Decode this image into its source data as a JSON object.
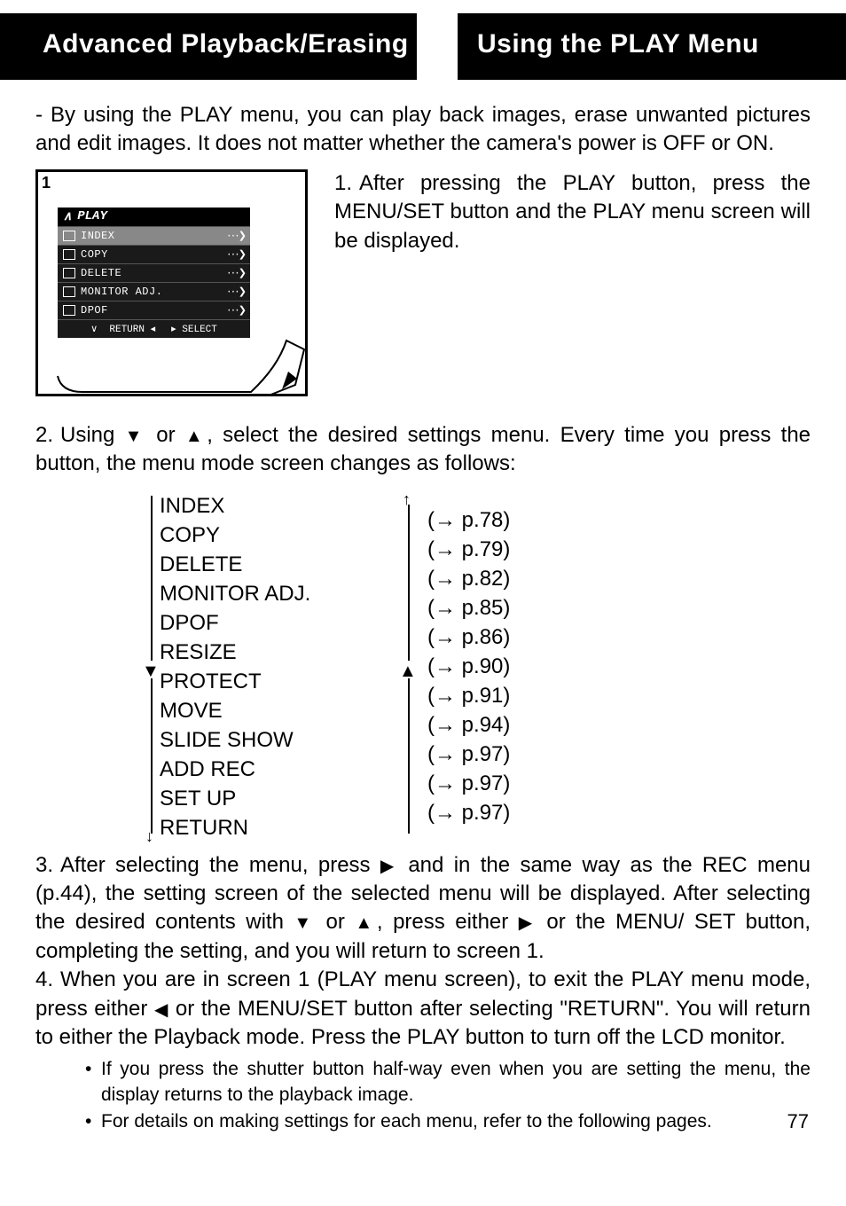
{
  "header": {
    "left": "Advanced Playback/Erasing",
    "right": "Using the PLAY Menu"
  },
  "intro": "By using the PLAY menu, you can play back images, erase unwanted pictures and edit images. It does not matter whether the camera's power is OFF or ON.",
  "lcd": {
    "number": "1",
    "title": "PLAY",
    "rows": [
      "INDEX",
      "COPY",
      "DELETE",
      "MONITOR ADJ.",
      "DPOF"
    ],
    "foot_return": "RETURN",
    "foot_select": "SELECT"
  },
  "step1": {
    "num": "1.",
    "text": "After pressing the PLAY button, press the MENU/SET button and the PLAY menu screen will be displayed."
  },
  "step2": {
    "num": "2.",
    "text_a": "Using ",
    "text_b": " or ",
    "text_c": ", select the desired settings menu. Every time you press the button, the menu mode screen changes as follows:"
  },
  "menu_list": {
    "items": [
      {
        "name": "INDEX",
        "ref": "p.78"
      },
      {
        "name": "COPY",
        "ref": "p.79"
      },
      {
        "name": "DELETE",
        "ref": "p.82"
      },
      {
        "name": "MONITOR ADJ.",
        "ref": "p.85"
      },
      {
        "name": "DPOF",
        "ref": "p.86"
      },
      {
        "name": "RESIZE",
        "ref": "p.90"
      },
      {
        "name": "PROTECT",
        "ref": "p.91"
      },
      {
        "name": "MOVE",
        "ref": "p.94"
      },
      {
        "name": "SLIDE SHOW",
        "ref": "p.97"
      },
      {
        "name": "ADD REC",
        "ref": "p.97"
      },
      {
        "name": "SET UP",
        "ref": "p.97"
      },
      {
        "name": "RETURN",
        "ref": ""
      }
    ]
  },
  "step3": {
    "num": "3.",
    "text_a": "After selecting the menu, press ",
    "text_b": " and in the same way as the REC menu (p.44), the setting screen of the selected menu will be displayed.  After selecting the desired contents with ",
    "text_c": " or ",
    "text_d": ", press either ",
    "text_e": " or the MENU/ SET button, completing the setting, and you will return to screen 1."
  },
  "step4": {
    "num": "4.",
    "text_a": "When you are in screen 1 (PLAY menu screen), to exit the PLAY menu mode, press either ",
    "text_b": " or the MENU/SET button after selecting \"RETURN\". You will return to either the Playback mode.  Press the PLAY button to turn off the LCD monitor."
  },
  "bullets": [
    "If you press the shutter button half-way even when you are setting the menu, the display returns to the playback image.",
    "For details on making settings for each menu, refer to the following pages."
  ],
  "page_number": "77"
}
